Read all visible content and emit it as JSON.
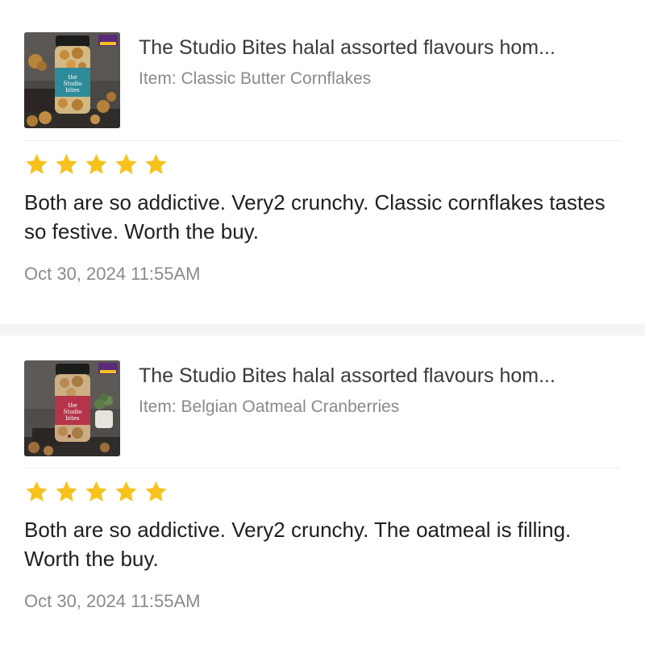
{
  "reviews": [
    {
      "product_title": "The Studio Bites halal assorted flavours hom...",
      "variant": "Item: Classic Butter Cornflakes",
      "rating": 5,
      "rating_max": 5,
      "text": "Both are so addictive. Very2 crunchy. Classic cornflakes tastes so festive. Worth the buy.",
      "date": "Oct 30, 2024 11:55AM",
      "thumbnail": {
        "icon": "product-jar-image",
        "jar_label": "the Studio bites",
        "badge_top": "The Studio",
        "badge_bottom": "BITES",
        "lid_color": "#1c1c1c",
        "band_color": "#2e8b99"
      }
    },
    {
      "product_title": "The Studio Bites halal assorted flavours hom...",
      "variant": "Item: Belgian Oatmeal Cranberries",
      "rating": 5,
      "rating_max": 5,
      "text": "Both are so addictive. Very2 crunchy. The oatmeal is filling. Worth the buy.",
      "date": "Oct 30, 2024 11:55AM",
      "thumbnail": {
        "icon": "product-jar-image",
        "jar_label": "the Studio bites",
        "badge_top": "The Studio",
        "badge_bottom": "BITES",
        "lid_color": "#1c1c1c",
        "band_color": "#b5344a"
      }
    }
  ],
  "colors": {
    "star": "#f7c21d",
    "text_primary": "#1f1f1f",
    "text_title": "#3a3a3a",
    "text_muted": "#8a8a8a",
    "divider_band": "#f5f5f5"
  }
}
